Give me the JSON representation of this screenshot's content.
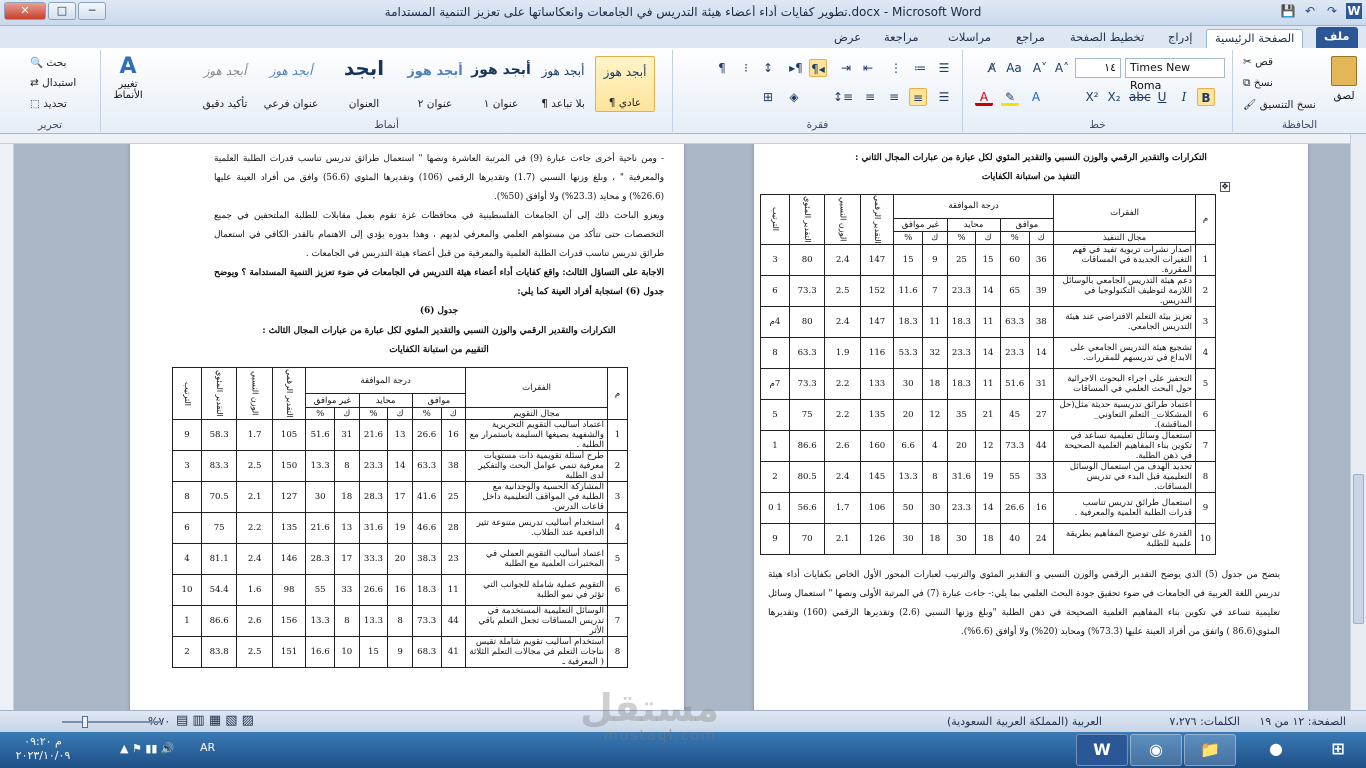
{
  "window": {
    "title": "تطوير كفايات أداء أعضاء هيئة التدريس في الجامعات وانعكاساتها على تعزيز التنمية المستدامة.docx - Microsoft Word",
    "controls": [
      "─",
      "□",
      "✕"
    ]
  },
  "tabs": {
    "file": "ملف",
    "items": [
      "الصفحة الرئيسية",
      "إدراج",
      "تخطيط الصفحة",
      "مراجع",
      "مراسلات",
      "مراجعة",
      "عرض"
    ]
  },
  "ribbon": {
    "clipboard": {
      "label": "الحافظة",
      "paste": "لصق",
      "cut": "قص",
      "copy": "نسخ",
      "format_painter": "نسخ التنسيق"
    },
    "font": {
      "label": "خط",
      "font_name": "Times New Roma",
      "font_size": "١٤"
    },
    "paragraph": {
      "label": "فقرة"
    },
    "styles": {
      "label": "أنماط",
      "items": [
        {
          "preview": "أبجد هوز",
          "name": "¶ عادي"
        },
        {
          "preview": "أبجد هوز",
          "name": "¶ بلا تباعد"
        },
        {
          "preview": "أبجد هوز",
          "name": "عنوان ١"
        },
        {
          "preview": "أبجد هوز",
          "name": "عنوان ٢"
        },
        {
          "preview": "ابجد",
          "name": "العنوان"
        },
        {
          "preview": "أبجد هوز",
          "name": "عنوان فرعي"
        },
        {
          "preview": "أبجد هوز",
          "name": "تأكيد دقيق"
        }
      ],
      "change": "تغيير الأنماط"
    },
    "editing": {
      "label": "تحرير",
      "find": "بحث",
      "replace": "استبدال",
      "select": "تحديد"
    }
  },
  "right_page": {
    "caption1": "التكرارات والتقدير الرقمي والوزن النسبي والتقدير المئوي لكل عبارة من عبارات المجال الثاني :",
    "caption2": "التنفيذ من استبانة الكفايات",
    "headers": {
      "m": "م",
      "b": "ب",
      "phrases": "الفقرات",
      "domain": "مجال التنفيذ",
      "degree": "درجة الموافقة",
      "agree": "موافق",
      "neutral": "محايد",
      "disagree": "غير موافق",
      "k": "ك",
      "pct": "%",
      "rating": "التقدير الرقمي",
      "weight": "الوزن النسبي",
      "percent": "التقدير المئوي",
      "rank": "الترتيب"
    },
    "rows": [
      [
        "1",
        "اصدار نشرات تربوية تفيد في فهم التغيرات الجديدة في المساقات المقررة.",
        "36",
        "60",
        "15",
        "25",
        "9",
        "15",
        "147",
        "2.4",
        "80",
        "3"
      ],
      [
        "2",
        "دعم هيئة التدريس الجامعي بالوسائل اللازمة لتوظيف التكنولوجيا في التدريس.",
        "39",
        "65",
        "14",
        "23.3",
        "7",
        "11.6",
        "152",
        "2.5",
        "73.3",
        "6"
      ],
      [
        "3",
        "تعزيز بيئة التعلم الافتراضي عند هيئة التدريس الجامعي.",
        "38",
        "63.3",
        "11",
        "18.3",
        "11",
        "18.3",
        "147",
        "2.4",
        "80",
        "4م"
      ],
      [
        "4",
        "تشجيع هيئة التدريس الجامعي على الابداع في تدريسهم للمقررات.",
        "14",
        "23.3",
        "14",
        "23.3",
        "32",
        "53.3",
        "116",
        "1.9",
        "63.3",
        "8"
      ],
      [
        "5",
        "التحفيز على اجراء البحوث الاجرائية حول البحث العلمي في المساقات",
        "31",
        "51.6",
        "11",
        "18.3",
        "18",
        "30",
        "133",
        "2.2",
        "73.3",
        "7م"
      ],
      [
        "6",
        "اعتماد طرائق تدريسية حديثة مثل(حل المشكلات_ التعلم التعاوني_ المناقشة).",
        "27",
        "45",
        "21",
        "35",
        "12",
        "20",
        "135",
        "2.2",
        "75",
        "5"
      ],
      [
        "7",
        "استعمال وسائل تعليمية تساعد في تكوين بناء المفاهيم العلمية الصحيحة في ذهن الطلبة.",
        "44",
        "73.3",
        "12",
        "20",
        "4",
        "6.6",
        "160",
        "2.6",
        "86.6",
        "1"
      ],
      [
        "8",
        "تحديد الهدف من استعمال الوسائل التعليمية قبل البدء في تدريس المساقات.",
        "33",
        "55",
        "19",
        "31.6",
        "8",
        "13.3",
        "145",
        "2.4",
        "80.5",
        "2"
      ],
      [
        "9",
        "استعمال طرائق تدريس تناسب قدرات الطلبة العلمية والمعرفية .",
        "16",
        "26.6",
        "14",
        "23.3",
        "30",
        "50",
        "106",
        "1.7",
        "56.6",
        "1 0"
      ],
      [
        "10",
        "القدرة على توضيح المفاهيم بطريقة علمية للطلبة",
        "24",
        "40",
        "18",
        "30",
        "18",
        "30",
        "126",
        "2.1",
        "70",
        "9"
      ]
    ],
    "para": "يتضح من جدول (5) الذي يوضح التقدير الرقمي والوزن النسبي و التقدير المئوي والترتيب لعبارات المحور الأول الخاص بكفايات أداء هيئة تدريس اللغة العربية في الجامعات في ضوء تحقيق جودة البحث العلمي بما يلي:- جاءت عبارة (7) في المرتبة الأولى ونصها \" استعمال وسائل تعليمية تساعد في تكوين بناء المفاهيم العلمية الصحيحة في ذهن الطلبة \"وبلغ وزنها النسبي (2.6) وتقديرها الرقمي (160) وتقديرها المئوي(86.6 ) واتفق من أفراد العينة عليها (73.3%) ومحايد (20%) ولا أوافق (6.6%)."
  },
  "left_page": {
    "p1": "- ومن ناحية أخرى جاءت عبارة (9) في المرتبة العاشرة ونصها \" استعمال طرائق تدريس تناسب قدرات الطلبة العلمية والمعرفية \" ، وبلغ وزنها النسبي (1.7) وتقديرها الرقمي (106) وتقديرها المئوي (56.6) وافق من أفراد العينة عليها (26.6%) و محايد (23.3%) ولا أوافق (50%).",
    "p2": "ويعزو الباحث ذلك إلى أن الجامعات الفلسطينية في محافظات غزة تقوم بعمل مقابلات للطلبة الملتحقين في جميع التخصصات حتى تتأكد من مستواهم العلمي والمعرفي لديهم ، وهذا بدوره يؤدي إلى الاهتمام بالقدر الكافي في استعمال طرائق تدريس تناسب قدرات الطلبة العلمية والمعرفية من قبل أعضاء هيئة التدريس في الجامعات .",
    "p3": "الاجابة على التساؤل الثالث: واقع كفايات أداء أعضاء هيئة التدريس في الجامعات في ضوء تعزيز التنمية المستدامة ؟ ويوضح جدول (6) استجابة أفراد العينة كما يلي:",
    "table_no": "جدول (6)",
    "caption1": "التكرارات والتقدير الرقمي والوزن النسبي والتقدير المئوي لكل عبارة من عبارات المجال الثالث :",
    "caption2": "التقييم من استبانة الكفايات",
    "headers": {
      "m": "م",
      "b": "ج",
      "domain": "مجال التقويم"
    },
    "rows": [
      [
        "1",
        "اعتماد أساليب التقويم التحريرية والشفهية بصيغها السليمة باستمرار مع الطلبة .",
        "16",
        "26.6",
        "13",
        "21.6",
        "31",
        "51.6",
        "105",
        "1.7",
        "58.3",
        "9"
      ],
      [
        "2",
        "طرح أسئلة تقويمية ذات مستويات معرفية تنمي عوامل البحث والتفكير لدى الطلبة",
        "38",
        "63.3",
        "14",
        "23.3",
        "8",
        "13.3",
        "150",
        "2.5",
        "83.3",
        "3"
      ],
      [
        "3",
        "المشاركة الحسية والوجدانية مع الطلبة في المواقف التعليمية داخل قاعات الدرس.",
        "25",
        "41.6",
        "17",
        "28.3",
        "18",
        "30",
        "127",
        "2.1",
        "70.5",
        "8"
      ],
      [
        "4",
        "استخدام أساليب تدريس متنوعة تثير الدافعية عند الطلاب.",
        "28",
        "46.6",
        "19",
        "31.6",
        "13",
        "21.6",
        "135",
        "2.2",
        "75",
        "6"
      ],
      [
        "5",
        "اعتماد أساليب التقويم العملي في المختبرات العلمية مع الطلبة",
        "23",
        "38.3",
        "20",
        "33.3",
        "17",
        "28.3",
        "146",
        "2.4",
        "81.1",
        "4"
      ],
      [
        "6",
        "التقويم عملية شاملة للجوانب التي تؤثر في نمو الطلبة",
        "11",
        "18.3",
        "16",
        "26.6",
        "33",
        "55",
        "98",
        "1.6",
        "54.4",
        "10"
      ],
      [
        "7",
        "الوسائل التعليمية المستخدمة في تدريس المساقات تجعل التعلم باقي الأثر",
        "44",
        "73.3",
        "8",
        "13.3",
        "8",
        "13.3",
        "156",
        "2.6",
        "86.6",
        "1"
      ],
      [
        "8",
        "استخدام أساليب تقويم شاملة تقيس نتاجات التعلم في مجالات التعلم الثلاثة ( المعرفية ـ",
        "41",
        "68.3",
        "9",
        "15",
        "10",
        "16.6",
        "151",
        "2.5",
        "83.8",
        "2"
      ]
    ]
  },
  "status": {
    "page": "الصفحة: ١٢ من ١٩",
    "words": "الكلمات: ٧،٢٧٦",
    "language": "العربية (المملكة العربية السعودية)",
    "zoom": "%٧٠"
  },
  "taskbar": {
    "time": "م ٠٩:٢٠",
    "date": "٢٠٢٣/١٠/٠٩",
    "lang": "AR"
  },
  "watermark": {
    "logo": "مستقل",
    "url": "mostaql.com"
  }
}
